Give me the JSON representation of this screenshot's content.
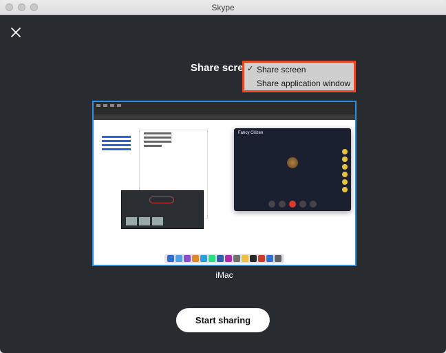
{
  "window": {
    "title": "Skype"
  },
  "share_heading": "Share screen",
  "dropdown": {
    "options": [
      {
        "label": "Share screen",
        "selected": true
      },
      {
        "label": "Share application window",
        "selected": false
      }
    ]
  },
  "preview": {
    "label": "iMac",
    "call_name": "Fancy Citizen",
    "dock_colors": [
      "#2f6fd0",
      "#4ea0e6",
      "#8c4fd0",
      "#e28a2a",
      "#2aa0d8",
      "#2adf80",
      "#3060b0",
      "#b02ab0",
      "#707070",
      "#f0c040",
      "#2a2a2a",
      "#d03a2a",
      "#3070d0",
      "#606060"
    ]
  },
  "start_button": "Start sharing",
  "annotation": {
    "highlight_color": "#e34a25"
  }
}
